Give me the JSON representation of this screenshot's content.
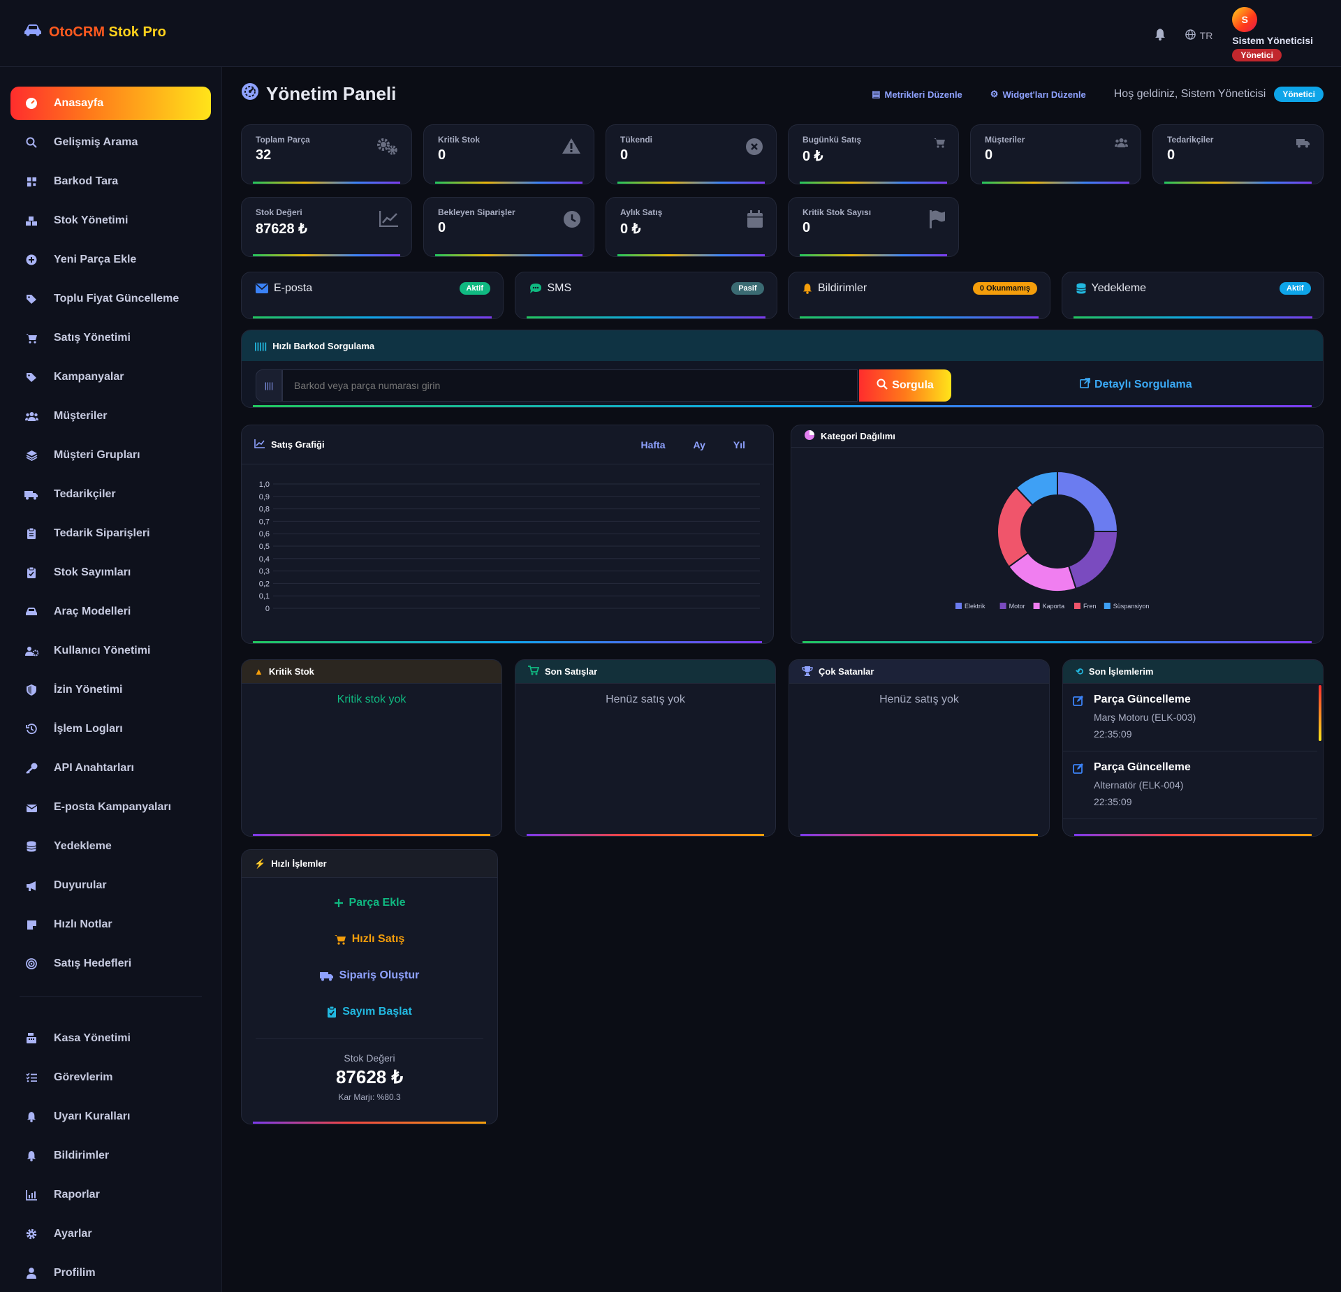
{
  "brand": {
    "part1": "OtoCRM",
    "part2": "Stok Pro"
  },
  "header": {
    "lang": "TR",
    "user_name": "Sistem Yöneticisi",
    "user_role": "Yönetici",
    "avatar_letter": "S"
  },
  "sidebar": {
    "items": [
      {
        "label": "Anasayfa",
        "icon": "dashboard-icon"
      },
      {
        "label": "Gelişmiş Arama",
        "icon": "search-icon"
      },
      {
        "label": "Barkod Tara",
        "icon": "qrcode-icon"
      },
      {
        "label": "Stok Yönetimi",
        "icon": "boxes-icon"
      },
      {
        "label": "Yeni Parça Ekle",
        "icon": "plus-circle-icon"
      },
      {
        "label": "Toplu Fiyat Güncelleme",
        "icon": "tags-icon"
      },
      {
        "label": "Satış Yönetimi",
        "icon": "cart-icon"
      },
      {
        "label": "Kampanyalar",
        "icon": "tag-icon"
      },
      {
        "label": "Müşteriler",
        "icon": "users-icon"
      },
      {
        "label": "Müşteri Grupları",
        "icon": "layers-icon"
      },
      {
        "label": "Tedarikçiler",
        "icon": "truck-icon"
      },
      {
        "label": "Tedarik Siparişleri",
        "icon": "clipboard-icon"
      },
      {
        "label": "Stok Sayımları",
        "icon": "clipboard-check-icon"
      },
      {
        "label": "Araç Modelleri",
        "icon": "car-icon"
      },
      {
        "label": "Kullanıcı Yönetimi",
        "icon": "users-cog-icon"
      },
      {
        "label": "İzin Yönetimi",
        "icon": "shield-icon"
      },
      {
        "label": "İşlem Logları",
        "icon": "history-icon"
      },
      {
        "label": "API Anahtarları",
        "icon": "key-icon"
      },
      {
        "label": "E-posta Kampanyaları",
        "icon": "mail-bulk-icon"
      },
      {
        "label": "Yedekleme",
        "icon": "database-icon"
      },
      {
        "label": "Duyurular",
        "icon": "megaphone-icon"
      },
      {
        "label": "Hızlı Notlar",
        "icon": "note-icon"
      },
      {
        "label": "Satış Hedefleri",
        "icon": "target-icon"
      }
    ],
    "bottom_items": [
      {
        "label": "Kasa Yönetimi",
        "icon": "cash-register-icon"
      },
      {
        "label": "Görevlerim",
        "icon": "tasks-icon"
      },
      {
        "label": "Uyarı Kuralları",
        "icon": "bell-icon"
      },
      {
        "label": "Bildirimler",
        "icon": "bell-icon"
      },
      {
        "label": "Raporlar",
        "icon": "chart-icon"
      },
      {
        "label": "Ayarlar",
        "icon": "gear-icon"
      },
      {
        "label": "Profilim",
        "icon": "user-icon"
      }
    ]
  },
  "page": {
    "title": "Yönetim Paneli",
    "edit_metrics": "Metrikleri Düzenle",
    "edit_widgets": "Widget'ları Düzenle",
    "welcome": "Hoş geldiniz, Sistem Yöneticisi",
    "role_badge": "Yönetici"
  },
  "metrics": [
    {
      "label": "Toplam Parça",
      "value": "32",
      "icon": "gears-icon"
    },
    {
      "label": "Kritik Stok",
      "value": "0",
      "icon": "warning-icon"
    },
    {
      "label": "Tükendi",
      "value": "0",
      "icon": "times-circle-icon"
    },
    {
      "label": "Bugünkü Satış",
      "value": "0 ₺",
      "icon": "cart-icon"
    },
    {
      "label": "Müşteriler",
      "value": "0",
      "icon": "users-icon"
    },
    {
      "label": "Tedarikçiler",
      "value": "0",
      "icon": "truck-icon"
    },
    {
      "label": "Stok Değeri",
      "value": "87628 ₺",
      "icon": "chart-line-icon"
    },
    {
      "label": "Bekleyen Siparişler",
      "value": "0",
      "icon": "clock-icon"
    },
    {
      "label": "Aylık Satış",
      "value": "0 ₺",
      "icon": "calendar-icon"
    },
    {
      "label": "Kritik Stok Sayısı",
      "value": "0",
      "icon": "flag-icon"
    }
  ],
  "services": [
    {
      "name": "E-posta",
      "status": "Aktif",
      "color": "#10b981",
      "icon": "envelope-icon"
    },
    {
      "name": "SMS",
      "status": "Pasif",
      "color": "#3b6b73",
      "icon": "sms-icon"
    },
    {
      "name": "Bildirimler",
      "status": "0 Okunmamış",
      "color": "#f59e0b",
      "icon": "bell-icon"
    },
    {
      "name": "Yedekleme",
      "status": "Aktif",
      "color": "#0ea5e9",
      "icon": "database-icon"
    }
  ],
  "barcode": {
    "title": "Hızlı Barkod Sorgulama",
    "placeholder": "Barkod veya parça numarası girin",
    "button": "Sorgula",
    "detail_link": "Detaylı Sorgulama"
  },
  "sales_chart": {
    "title": "Satış Grafiği",
    "tabs": [
      "Hafta",
      "Ay",
      "Yıl"
    ]
  },
  "category_chart": {
    "title": "Kategori Dağılımı"
  },
  "chart_data": [
    {
      "type": "line",
      "title": "Satış Grafiği",
      "y_ticks": [
        "1,0",
        "0,9",
        "0,8",
        "0,7",
        "0,6",
        "0,5",
        "0,4",
        "0,3",
        "0,2",
        "0,1",
        "0"
      ],
      "ylim": [
        0,
        1
      ],
      "series": [],
      "grid": true
    },
    {
      "type": "pie",
      "title": "Kategori Dağılımı",
      "categories": [
        "Elektrik",
        "Motor",
        "Kaporta",
        "Fren",
        "Süspansiyon"
      ],
      "values": [
        25,
        20,
        20,
        23,
        12
      ],
      "colors": [
        "#6b7cf0",
        "#7a4bbf",
        "#f07ef0",
        "#f0556b",
        "#3ea0f5"
      ],
      "legend": "bottom"
    }
  ],
  "panels": {
    "critical": {
      "title": "Kritik Stok",
      "empty": "Kritik stok yok"
    },
    "last_sales": {
      "title": "Son Satışlar",
      "empty": "Henüz satış yok"
    },
    "best_sellers": {
      "title": "Çok Satanlar",
      "empty": "Henüz satış yok"
    },
    "my_actions": {
      "title": "Son İşlemlerim",
      "items": [
        {
          "title": "Parça Güncelleme",
          "detail": "Marş Motoru (ELK-003)",
          "time": "22:35:09"
        },
        {
          "title": "Parça Güncelleme",
          "detail": "Alternatör (ELK-004)",
          "time": "22:35:09"
        }
      ]
    }
  },
  "quick_actions": {
    "title": "Hızlı İşlemler",
    "items": [
      {
        "label": "Parça Ekle",
        "color": "#10b981",
        "icon": "plus-icon"
      },
      {
        "label": "Hızlı Satış",
        "color": "#f59e0b",
        "icon": "cart-icon"
      },
      {
        "label": "Sipariş Oluştur",
        "color": "#8fa2ff",
        "icon": "truck-icon"
      },
      {
        "label": "Sayım Başlat",
        "color": "#22b8e0",
        "icon": "clipboard-check-icon"
      }
    ],
    "stock_value_label": "Stok Değeri",
    "stock_value": "87628 ₺",
    "margin": "Kar Marjı: %80.3"
  }
}
